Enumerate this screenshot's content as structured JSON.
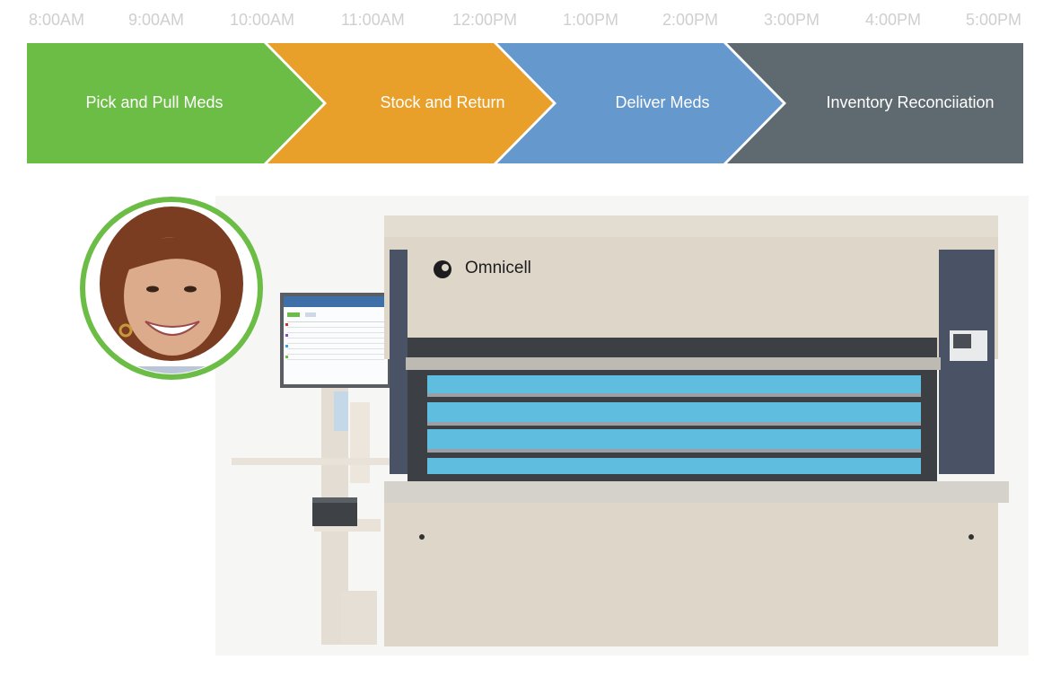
{
  "timeline": {
    "times": [
      "8:00AM",
      "9:00AM",
      "10:00AM",
      "11:00AM",
      "12:00PM",
      "1:00PM",
      "2:00PM",
      "3:00PM",
      "4:00PM",
      "5:00PM"
    ]
  },
  "stages": [
    {
      "label": "Pick and Pull Meds",
      "color": "#6cbd45"
    },
    {
      "label": "Stock and Return",
      "color": "#e9a02a"
    },
    {
      "label": "Deliver Meds",
      "color": "#6598cd"
    },
    {
      "label": "Inventory Reconciiation",
      "color": "#5f6a70"
    }
  ],
  "machine": {
    "brand": "Omnicell"
  },
  "colors": {
    "avatar_ring": "#6cbd45",
    "timeline_text": "#cfcfcf",
    "drawer_blue": "#5fbde0"
  }
}
